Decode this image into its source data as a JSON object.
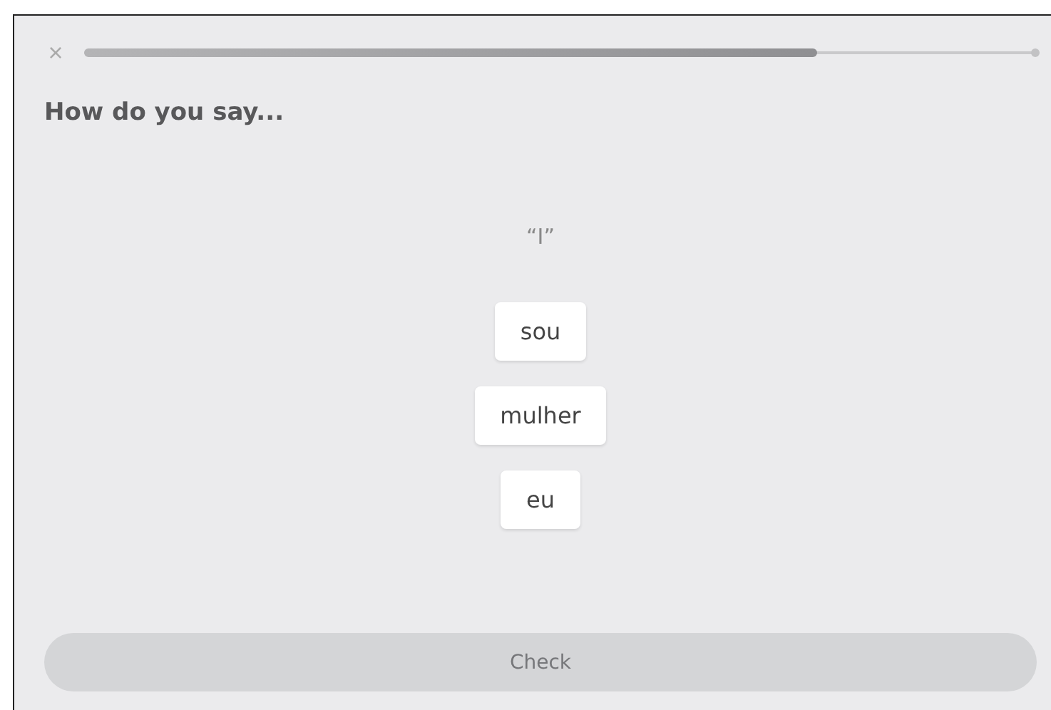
{
  "close": {
    "label": "×"
  },
  "progress": {
    "level": 0.77
  },
  "heading": "How do you say...",
  "prompt": "“I”",
  "options": [
    {
      "label": "sou"
    },
    {
      "label": "mulher"
    },
    {
      "label": "eu"
    }
  ],
  "check_button": {
    "label": "Check",
    "disabled": true
  }
}
